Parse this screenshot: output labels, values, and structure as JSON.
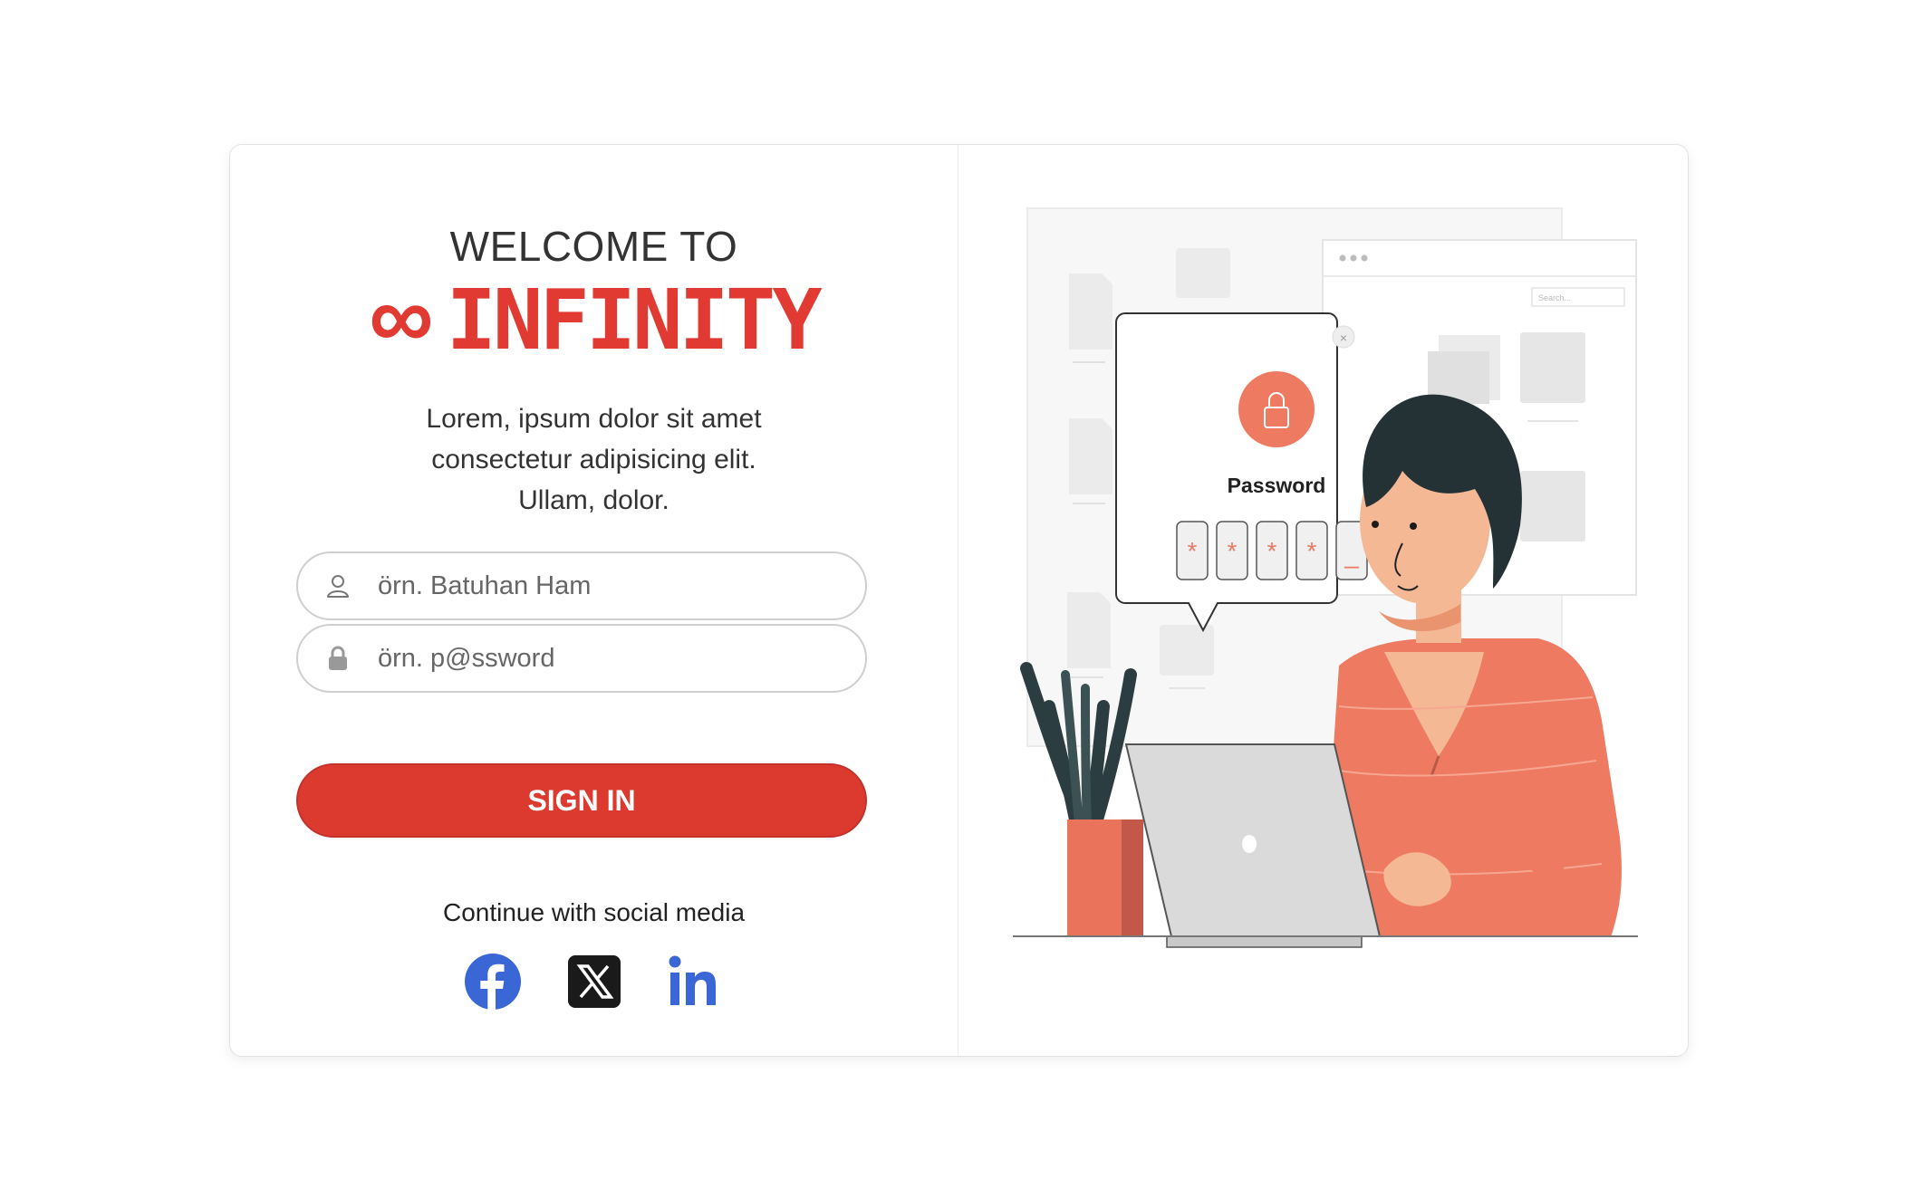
{
  "login": {
    "welcome": "WELCOME TO",
    "brand_symbol": "∞",
    "brand_name": "INFINITY",
    "description_lines": [
      "Lorem, ipsum dolor sit amet",
      "consectetur adipisicing elit.",
      "Ullam, dolor."
    ],
    "username_placeholder": "örn. Batuhan Ham",
    "password_placeholder": "örn. p@ssword",
    "signin_label": "SIGN IN",
    "social_label": "Continue with social media",
    "social_icons": [
      "facebook-icon",
      "x-icon",
      "linkedin-icon"
    ]
  },
  "illustration": {
    "dialog_title": "Password",
    "search_placeholder": "Search...",
    "pin_chars": [
      "*",
      "*",
      "*",
      "*",
      "_"
    ]
  },
  "colors": {
    "brand": "#e03a32",
    "button": "#dc3a2e",
    "social_blue": "#3b66d6",
    "illustration_accent": "#ee7a62"
  }
}
